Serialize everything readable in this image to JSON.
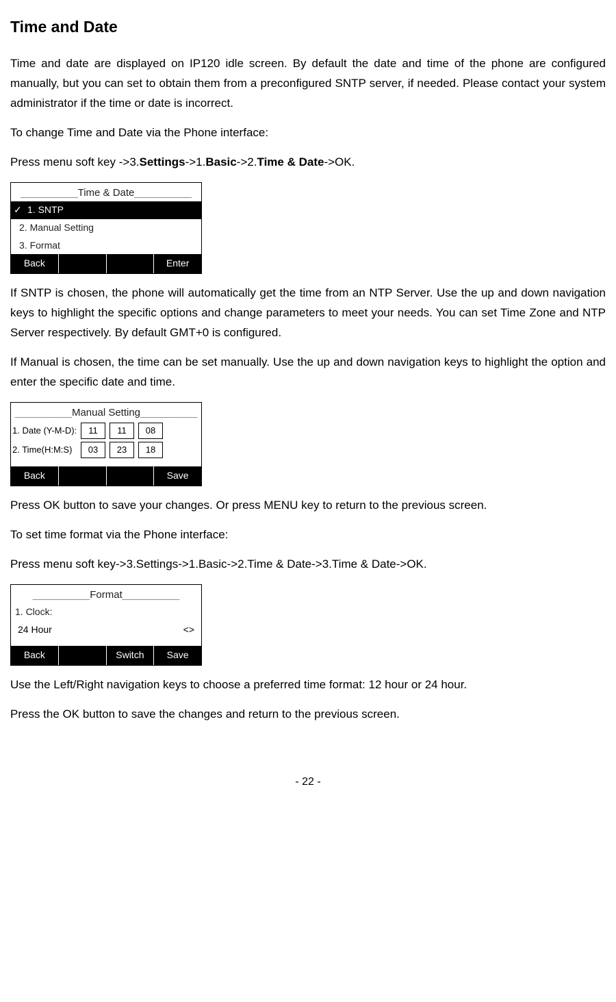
{
  "heading": "Time and Date",
  "para1": "Time and date are displayed on IP120 idle screen. By default the date and time of the phone are configured manually, but you can set to obtain them from a preconfigured SNTP server, if needed. Please contact your system administrator if the time or date is incorrect.",
  "para2": "To change Time and Date via the Phone interface:",
  "para3_prefix": "Press menu soft key ->3.",
  "para3_b1": "Settings",
  "para3_m1": "->1.",
  "para3_b2": "Basic",
  "para3_m2": "->2.",
  "para3_b3": "Time & Date",
  "para3_suffix": "->OK.",
  "screen1": {
    "title": "Time & Date",
    "item1": "1. SNTP",
    "item2": "2. Manual Setting",
    "item3": "3. Format",
    "soft_left": "Back",
    "soft_right": "Enter"
  },
  "para4": "If SNTP is chosen, the phone will automatically get the time from an NTP Server. Use the up and down navigation keys to highlight the specific options and change parameters to meet your needs. You can set Time Zone and NTP Server respectively. By default GMT+0 is configured.",
  "para5": "If Manual is chosen, the time can be set manually. Use the up and down navigation keys to highlight the option and enter the specific date and time.",
  "screen2": {
    "title": "Manual Setting",
    "row1_label": "1. Date (Y-M-D):",
    "row1_v1": "11",
    "row1_v2": "11",
    "row1_v3": "08",
    "row2_label": "2. Time(H:M:S)",
    "row2_v1": "03",
    "row2_v2": "23",
    "row2_v3": "18",
    "soft_left": "Back",
    "soft_right": "Save"
  },
  "para6": "Press OK button to save your changes. Or press MENU key to return to the previous screen.",
  "para7": "To set time format via the Phone interface:",
  "para8": "Press menu soft key->3.Settings->1.Basic->2.Time & Date->3.Time & Date->OK.",
  "screen3": {
    "title": "Format",
    "row1_label": "1. Clock:",
    "row2_label": "24 Hour",
    "arrows": "<>",
    "soft_left": "Back",
    "soft_mid": "Switch",
    "soft_right": "Save"
  },
  "para9": "Use the Left/Right navigation keys to choose a preferred time format: 12 hour or 24 hour.",
  "para10": "Press the OK button to save the changes and return to the previous screen.",
  "page_number": "- 22 -"
}
